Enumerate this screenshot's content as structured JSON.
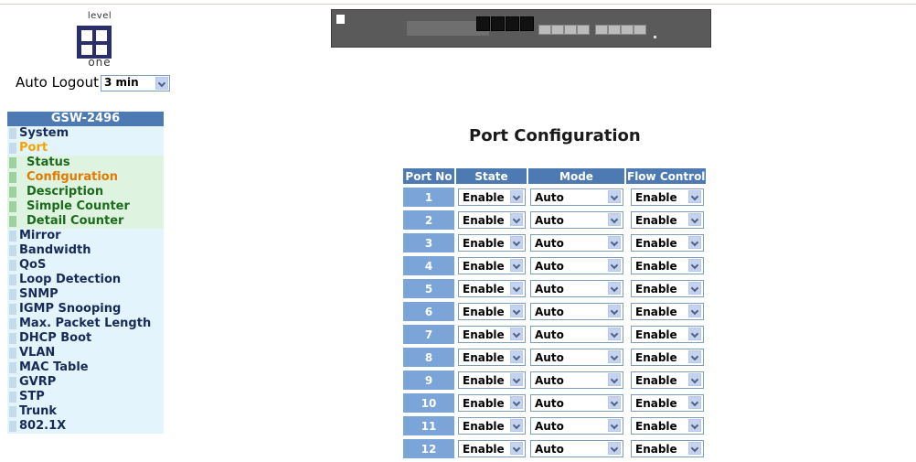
{
  "brand": {
    "logo_top": "level",
    "logo_bottom": "one"
  },
  "auto_logout": {
    "label": "Auto Logout",
    "value": "3 min"
  },
  "sidebar": {
    "title": "GSW-2496",
    "items": [
      {
        "label": "System"
      },
      {
        "label": "Port",
        "active": true
      },
      {
        "label": "Status",
        "sub": true
      },
      {
        "label": "Configuration",
        "sub": true,
        "current": true
      },
      {
        "label": "Description",
        "sub": true
      },
      {
        "label": "Simple Counter",
        "sub": true
      },
      {
        "label": "Detail Counter",
        "sub": true
      },
      {
        "label": "Mirror"
      },
      {
        "label": "Bandwidth"
      },
      {
        "label": "QoS"
      },
      {
        "label": "Loop Detection"
      },
      {
        "label": "SNMP"
      },
      {
        "label": "IGMP Snooping"
      },
      {
        "label": "Max. Packet Length"
      },
      {
        "label": "DHCP Boot"
      },
      {
        "label": "VLAN"
      },
      {
        "label": "MAC Table"
      },
      {
        "label": "GVRP"
      },
      {
        "label": "STP"
      },
      {
        "label": "Trunk"
      },
      {
        "label": "802.1X"
      }
    ]
  },
  "page": {
    "title": "Port Configuration",
    "columns": [
      "Port No",
      "State",
      "Mode",
      "Flow Control"
    ],
    "rows": [
      {
        "port": "1",
        "state": "Enable",
        "mode": "Auto",
        "flow": "Enable"
      },
      {
        "port": "2",
        "state": "Enable",
        "mode": "Auto",
        "flow": "Enable"
      },
      {
        "port": "3",
        "state": "Enable",
        "mode": "Auto",
        "flow": "Enable"
      },
      {
        "port": "4",
        "state": "Enable",
        "mode": "Auto",
        "flow": "Enable"
      },
      {
        "port": "5",
        "state": "Enable",
        "mode": "Auto",
        "flow": "Enable"
      },
      {
        "port": "6",
        "state": "Enable",
        "mode": "Auto",
        "flow": "Enable"
      },
      {
        "port": "7",
        "state": "Enable",
        "mode": "Auto",
        "flow": "Enable"
      },
      {
        "port": "8",
        "state": "Enable",
        "mode": "Auto",
        "flow": "Enable"
      },
      {
        "port": "9",
        "state": "Enable",
        "mode": "Auto",
        "flow": "Enable"
      },
      {
        "port": "10",
        "state": "Enable",
        "mode": "Auto",
        "flow": "Enable"
      },
      {
        "port": "11",
        "state": "Enable",
        "mode": "Auto",
        "flow": "Enable"
      },
      {
        "port": "12",
        "state": "Enable",
        "mode": "Auto",
        "flow": "Enable"
      }
    ]
  },
  "colors": {
    "header_blue": "#4d7ab3",
    "port_cell_blue": "#7ba5d8",
    "active_menu": "#f4a400",
    "current_submenu": "#e37a00"
  }
}
